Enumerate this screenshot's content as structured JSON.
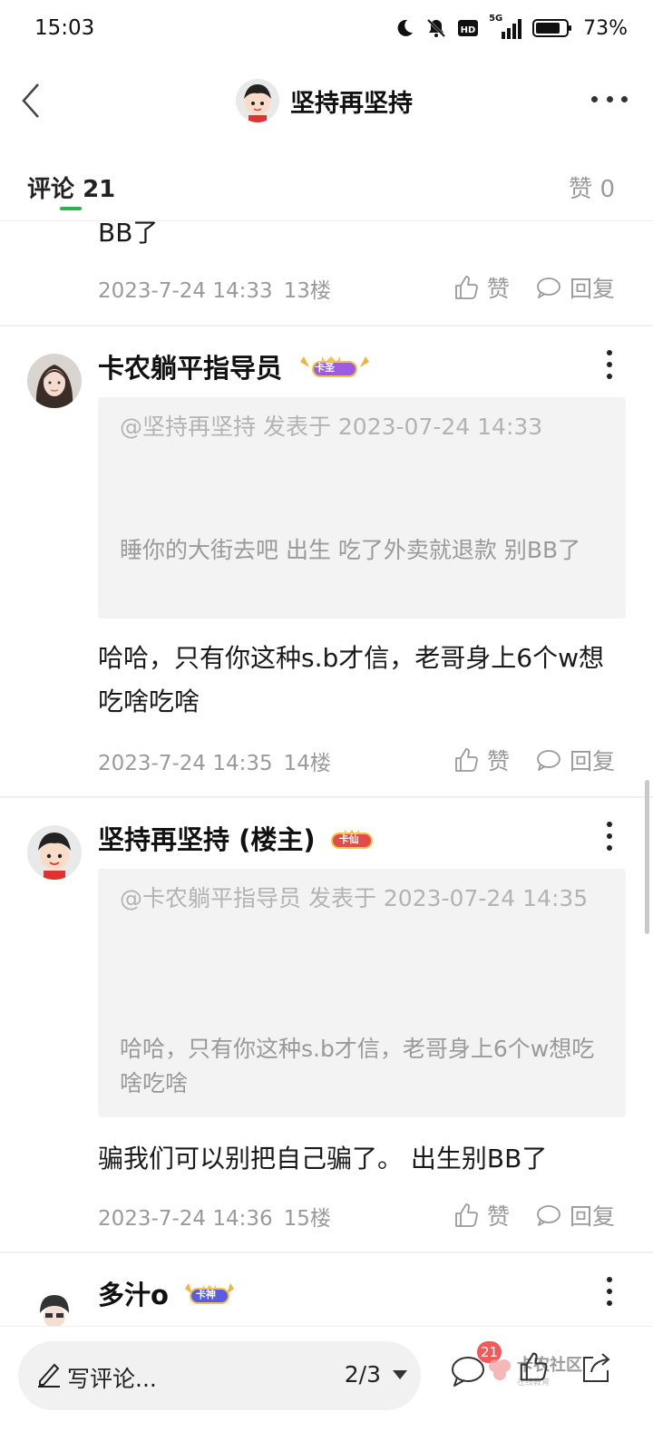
{
  "status_bar": {
    "time": "15:03",
    "network": "5G",
    "battery": "73%",
    "icons": [
      "moon-icon",
      "bell-off-icon",
      "hd-icon",
      "signal-icon",
      "battery-icon"
    ]
  },
  "header": {
    "title": "坚持再坚持"
  },
  "tabs": {
    "comments_label": "评论",
    "comments_count": "21",
    "likes_label": "赞",
    "likes_count": "0",
    "accent_color": "#2bb24c"
  },
  "comments": [
    {
      "partial_text": "BB了",
      "time": "2023-7-24 14:33",
      "floor": "13楼",
      "like_label": "赞",
      "reply_label": "回复"
    },
    {
      "username": "卡农躺平指导员",
      "badge": "卡圣",
      "quote_head": "@坚持再坚持 发表于 2023-07-24 14:33",
      "quote_text": "睡你的大街去吧 出生 吃了外卖就退款 别BB了",
      "text": "哈哈，只有你这种s.b才信，老哥身上6个w想吃啥吃啥",
      "time": "2023-7-24 14:35",
      "floor": "14楼",
      "like_label": "赞",
      "reply_label": "回复"
    },
    {
      "username": "坚持再坚持 (楼主)",
      "badge": "卡仙",
      "quote_head": "@卡农躺平指导员 发表于 2023-07-24 14:35",
      "quote_text": "哈哈，只有你这种s.b才信，老哥身上6个w想吃啥吃啥",
      "text": "骗我们可以别把自己骗了。 出生别BB了",
      "time": "2023-7-24 14:36",
      "floor": "15楼",
      "like_label": "赞",
      "reply_label": "回复"
    },
    {
      "username": "多汁o",
      "badge": "卡神"
    }
  ],
  "bottom_bar": {
    "comment_placeholder": "写评论...",
    "page": "2/3",
    "comment_count_badge": "21",
    "watermark_title": "卡农社区",
    "watermark_sub": "在线教育"
  }
}
